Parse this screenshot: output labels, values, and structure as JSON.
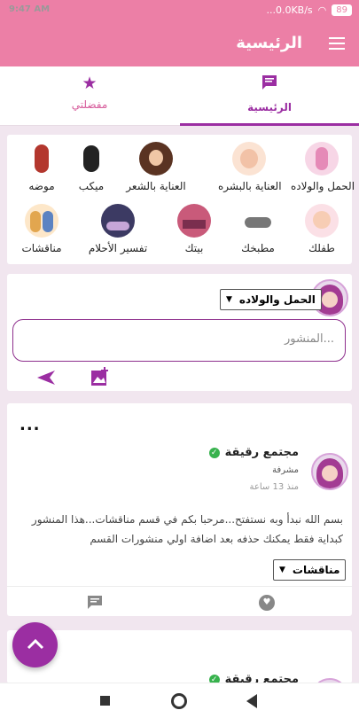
{
  "status_bar": {
    "time": "9:47 AM",
    "network": "...0.0KB/s",
    "battery": "89"
  },
  "app_bar": {
    "title": "الرئيسية",
    "menu_icon": "hamburger-icon"
  },
  "tabs": [
    {
      "label": "الرئيسية",
      "icon": "chat-icon",
      "selected": true
    },
    {
      "label": "مفضلتي",
      "icon": "star-icon",
      "selected": false
    }
  ],
  "categories": {
    "row1": [
      "الحمل والولاده",
      "العناية بالبشره",
      "العناية بالشعر",
      "ميكب",
      "موضه"
    ],
    "row2": [
      "طفلك",
      "مطبخك",
      "بيتك",
      "تفسير الأحلام",
      "مناقشات"
    ]
  },
  "composer": {
    "category_select": "الحمل والولاده",
    "placeholder": "المنشور..."
  },
  "post": {
    "author": "مجتمع رقيقة",
    "role": "مشرفة",
    "time": "منذ 13 ساعة",
    "body": "بسم الله نبدأ وبه نستفتح...مرحبا بكم في قسم مناقشات...هذا المنشور كبداية فقط يمكنك حذفه بعد اضافة اولي منشورات القسم",
    "tag": "مناقشات",
    "more_label": "..."
  },
  "post2": {
    "author": "مجتمع رقيقة"
  },
  "colors": {
    "primary": "#ec7fa6",
    "accent": "#9b2ea2",
    "background": "#f1e6ef"
  }
}
